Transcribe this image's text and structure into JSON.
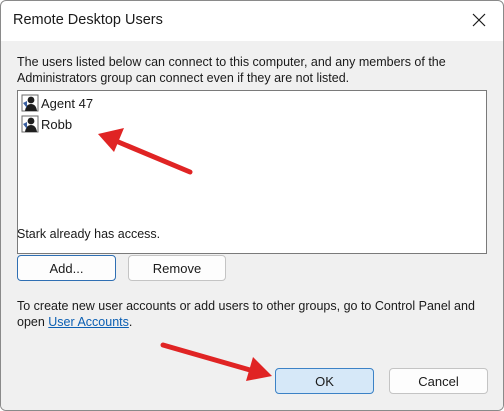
{
  "window": {
    "title": "Remote Desktop Users"
  },
  "description": "The users listed below can connect to this computer, and any members of the Administrators group can connect even if they are not listed.",
  "users": [
    {
      "name": "Agent 47",
      "icon": "user-icon"
    },
    {
      "name": "Robb",
      "icon": "user-icon"
    }
  ],
  "access_note": "Stark already has access.",
  "buttons": {
    "add": "Add...",
    "remove": "Remove",
    "ok": "OK",
    "cancel": "Cancel"
  },
  "info": {
    "prefix": "To create new user accounts or add users to other groups, go to Control Panel and open ",
    "link": "User Accounts",
    "suffix": "."
  },
  "colors": {
    "annotation_arrow": "#e02424",
    "ok_background": "#d6e8f8",
    "link": "#0b5fb3"
  }
}
